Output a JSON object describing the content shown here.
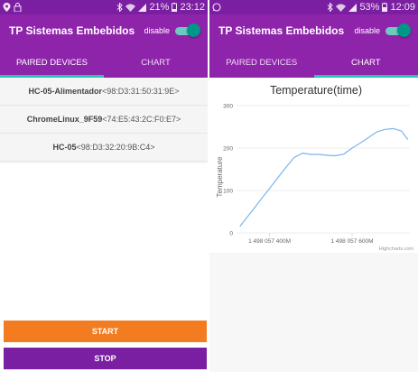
{
  "colors": {
    "appbar": "#8e24aa",
    "statusbar": "#7b1fa2",
    "accent": "#26c6b5",
    "toggle_knob": "#009688",
    "start_button": "#f47c20",
    "stop_button": "#7a1fa2",
    "series_line": "#7cb5ec"
  },
  "left": {
    "status": {
      "time": "23:12",
      "battery": "21%"
    },
    "app_title": "TP Sistemas Embebidos",
    "switch_label": "disable",
    "tabs": [
      {
        "label": "PAIRED DEVICES"
      },
      {
        "label": "CHART"
      }
    ],
    "selected_tab": 0,
    "devices": [
      {
        "name": "HC-05-Alimentador",
        "address": "<98:D3:31:50:31:9E>"
      },
      {
        "name": "ChromeLinux_9F59",
        "address": "<74:E5:43:2C:F0:E7>"
      },
      {
        "name": "HC-05",
        "address": "<98:D3:32:20:9B:C4>"
      }
    ],
    "start_label": "START",
    "stop_label": "STOP"
  },
  "right": {
    "status": {
      "time": "12:09",
      "battery": "53%"
    },
    "app_title": "TP Sistemas Embebidos",
    "switch_label": "disable",
    "tabs": [
      {
        "label": "PAIRED DEVICES"
      },
      {
        "label": "CHART"
      }
    ],
    "selected_tab": 1,
    "credit": "Highcharts.com"
  },
  "chart_data": {
    "type": "line",
    "title": "Temperature(time)",
    "xlabel": "",
    "ylabel": "Temperature",
    "ylim": [
      0,
      300
    ],
    "yticks": [
      "0",
      "100",
      "200",
      "300"
    ],
    "xticks": [
      {
        "value": 1498057400000,
        "label": "1 498 057 400M"
      },
      {
        "value": 1498057600000,
        "label": "1 498 057 600M"
      }
    ],
    "xlim": [
      1498057320000,
      1498057740000
    ],
    "grid": true,
    "legend": "none",
    "series": [
      {
        "x": [
          1498057328000,
          1498057340000,
          1498057360000,
          1498057380000,
          1498057400000,
          1498057420000,
          1498057440000,
          1498057460000,
          1498057480000,
          1498057500000,
          1498057520000,
          1498057540000,
          1498057560000,
          1498057580000,
          1498057600000,
          1498057620000,
          1498057640000,
          1498057660000,
          1498057680000,
          1498057700000,
          1498057720000,
          1498057735000
        ],
        "values": [
          15,
          30,
          55,
          80,
          105,
          130,
          155,
          178,
          188,
          185,
          185,
          183,
          182,
          186,
          200,
          212,
          225,
          238,
          244,
          246,
          240,
          220
        ]
      }
    ]
  }
}
